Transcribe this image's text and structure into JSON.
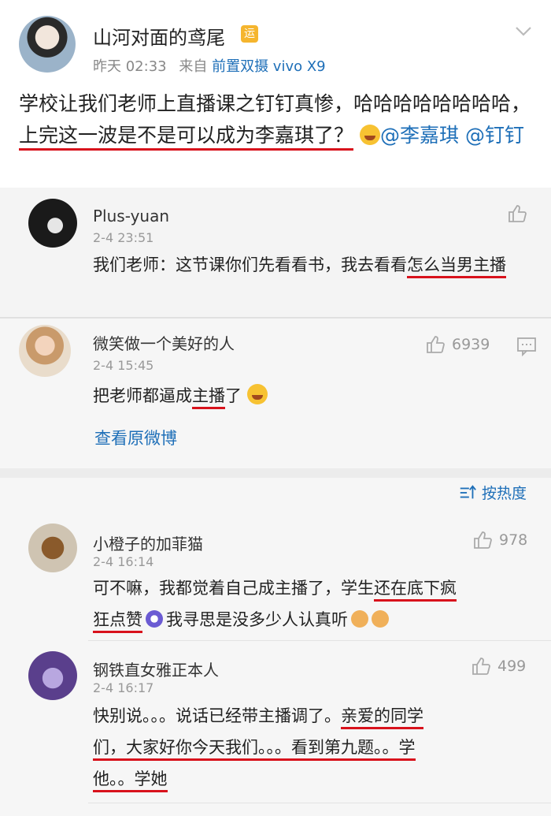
{
  "post": {
    "author": "山河对面的鸢尾",
    "badge": "运",
    "time": "昨天 02:33",
    "source_prefix": "来自",
    "source": "前置双摄 vivo X9",
    "text_1": "学校让我们老师上直播课之钉钉真惨，哈哈哈哈哈哈哈哈，",
    "text_underlined": "上完这一波是不是可以成为李嘉琪了？",
    "mention_1": "@李嘉琪",
    "mention_2": "@钉钉"
  },
  "comments_inline": [
    {
      "name": "Plus-yuan",
      "time": "2-4 23:51",
      "text_1": "我们老师：这节课你们先看看书，我去看看",
      "text_u": "怎么当男主播"
    },
    {
      "name": "微笑做一个美好的人",
      "time": "2-4 15:45",
      "likes": "6939",
      "text_1": "把老师都逼成",
      "text_u": "主播",
      "text_2": "了"
    }
  ],
  "view_original": "查看原微博",
  "sort_label": "按热度",
  "comments": [
    {
      "name": "小橙子的加菲猫",
      "time": "2-4 16:14",
      "likes": "978",
      "text_1": "可不嘛，我都觉着自己成主播了，学生",
      "text_u1": "还在底下疯",
      "text_u2": "狂点赞",
      "text_2": "我寻思是没多少人认真听"
    },
    {
      "name": "钢铁直女雅正本人",
      "time": "2-4 16:17",
      "likes": "499",
      "text_1": "快别说。。。说话已经带主播调了。",
      "text_u1": "亲爱的同学",
      "text_u2": "们，大家好你今天我们。。。看到第九题。。学",
      "text_u3": "他。。学她"
    }
  ],
  "colors": {
    "link": "#1e6fb8",
    "underline": "#d8121c",
    "badge": "#f5b52e"
  }
}
